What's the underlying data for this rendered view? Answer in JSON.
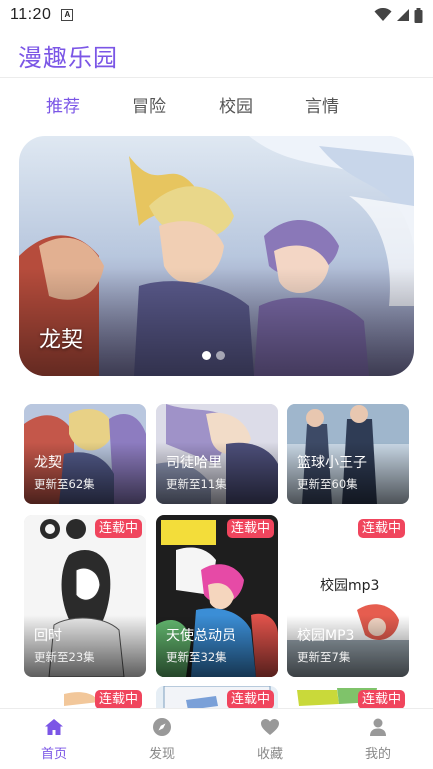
{
  "status_bar": {
    "time": "11:20",
    "notification_letter": "A"
  },
  "app": {
    "title": "漫趣乐园"
  },
  "tabs": [
    {
      "label": "推荐",
      "active": true
    },
    {
      "label": "冒险",
      "active": false
    },
    {
      "label": "校园",
      "active": false
    },
    {
      "label": "言情",
      "active": false
    }
  ],
  "banner": {
    "title": "龙契",
    "page_count": 2,
    "active_page": 1
  },
  "comics": [
    {
      "title": "龙契",
      "update": "更新至62集",
      "badge": ""
    },
    {
      "title": "司徒哈里",
      "update": "更新至11集",
      "badge": ""
    },
    {
      "title": "篮球小王子",
      "update": "更新至60集",
      "badge": ""
    },
    {
      "title": "回时",
      "update": "更新至23集",
      "badge": "连载中"
    },
    {
      "title": "天使总动员",
      "update": "更新至32集",
      "badge": "连载中"
    },
    {
      "title": "校园MP3",
      "update": "更新至7集",
      "badge": "连载中",
      "cover_text": "校园mp3"
    },
    {
      "title": "",
      "update": "",
      "badge": "连载中"
    },
    {
      "title": "",
      "update": "",
      "badge": "连载中"
    },
    {
      "title": "",
      "update": "",
      "badge": "连载中"
    }
  ],
  "bottom_nav": [
    {
      "label": "首页",
      "icon": "home-icon",
      "active": true
    },
    {
      "label": "发现",
      "icon": "compass-icon",
      "active": false
    },
    {
      "label": "收藏",
      "icon": "heart-icon",
      "active": false
    },
    {
      "label": "我的",
      "icon": "user-icon",
      "active": false
    }
  ],
  "colors": {
    "accent": "#7b56e6",
    "badge": "#f0455d",
    "nav_inactive": "#888888"
  }
}
